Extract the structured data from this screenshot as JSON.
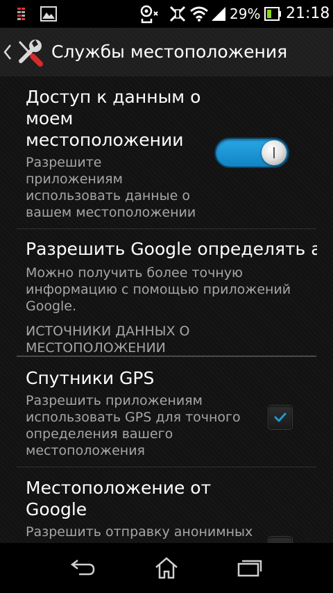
{
  "status_bar": {
    "icons": [
      "sd-card-icon",
      "image-icon",
      "usb-debug-icon",
      "no-vibrate-icon",
      "wifi-icon",
      "signal-icon",
      "battery-icon"
    ],
    "battery_percent": "29%",
    "time": "21:18"
  },
  "action_bar": {
    "back_icon": "chevron-left-icon",
    "app_icon": "tools-icon",
    "title": "Службы местоположения"
  },
  "settings": {
    "location_access": {
      "title_lines": [
        "Доступ к данным о",
        "моем",
        "местоположении"
      ],
      "summary_lines": [
        "Разрешите",
        "приложениям",
        "использовать данные о",
        "вашем местоположении"
      ],
      "enabled": true
    },
    "google_location": {
      "title": "Разрешить Google определять а",
      "summary_lines": [
        "Можно получить более точную",
        "информацию с помощью приложений",
        "Google."
      ]
    },
    "section": {
      "header_lines": [
        "ИСТОЧНИКИ ДАННЫХ О",
        "МЕСТОПОЛОЖЕНИИ"
      ]
    },
    "gps": {
      "title": "Спутники GPS",
      "summary_lines": [
        "Разрешить приложениям",
        "использовать GPS для точного",
        "определения вашего",
        "местоположения"
      ],
      "checked": true
    },
    "google_network": {
      "title_lines": [
        "Местоположение от",
        "Google"
      ],
      "summary_lines": [
        "Разрешить отправку анонимных"
      ],
      "checked": false
    }
  },
  "nav_bar": {
    "buttons": [
      "back-icon",
      "home-icon",
      "recents-icon"
    ]
  },
  "colors": {
    "accent": "#1a9ad9",
    "background": "#121212",
    "summary_text": "#a6a6a6"
  }
}
